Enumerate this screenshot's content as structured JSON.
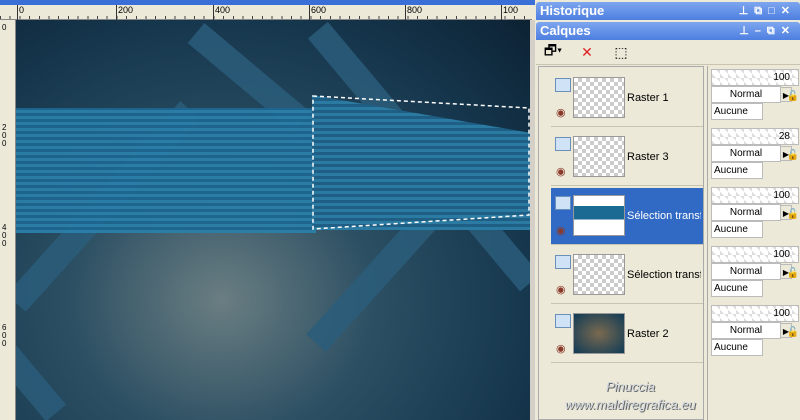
{
  "ruler": {
    "h_labels": [
      "0",
      "200",
      "400",
      "600",
      "800",
      "100"
    ],
    "v_labels": [
      "0",
      "200",
      "400",
      "600"
    ]
  },
  "history_panel": {
    "title": "Historique"
  },
  "layers_panel": {
    "title": "Calques",
    "layers": [
      {
        "name": "Raster 1",
        "opacity": "100",
        "blend": "Normal",
        "mask": "Aucune",
        "selected": false
      },
      {
        "name": "Raster 3",
        "opacity": "28",
        "blend": "Normal",
        "mask": "Aucune",
        "selected": false
      },
      {
        "name": "Sélection transformée",
        "opacity": "100",
        "blend": "Normal",
        "mask": "Aucune",
        "selected": true
      },
      {
        "name": "Sélection transformée",
        "opacity": "100",
        "blend": "Normal",
        "mask": "Aucune",
        "selected": false
      },
      {
        "name": "Raster 2",
        "opacity": "100",
        "blend": "Normal",
        "mask": "Aucune",
        "selected": false
      }
    ]
  },
  "watermark": {
    "line1": "Pinuccia",
    "line2": "www.maldiregrafica.eu"
  },
  "colors": {
    "selected": "#316ac5",
    "titlebar": "#4d7fe0"
  }
}
